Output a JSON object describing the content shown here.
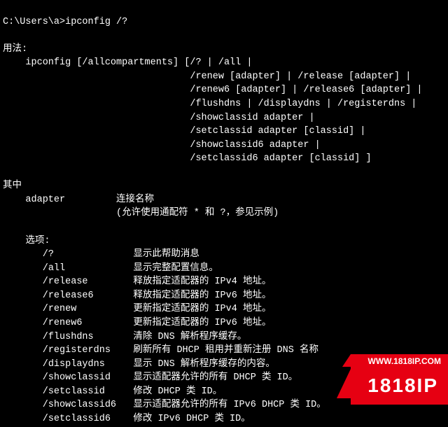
{
  "prompt": "C:\\Users\\a>ipconfig /?",
  "usage_label": "用法:",
  "usage_lines": [
    "    ipconfig [/allcompartments] [/? | /all |",
    "                                 /renew [adapter] | /release [adapter] |",
    "                                 /renew6 [adapter] | /release6 [adapter] |",
    "                                 /flushdns | /displaydns | /registerdns |",
    "                                 /showclassid adapter |",
    "                                 /setclassid adapter [classid] |",
    "                                 /showclassid6 adapter |",
    "                                 /setclassid6 adapter [classid] ]"
  ],
  "where_label": "其中",
  "adapter_key": "    adapter",
  "adapter_desc1": "连接名称",
  "adapter_desc2": "(允许使用通配符 * 和 ?，参见示例)",
  "options_label": "    选项:",
  "options": [
    {
      "flag": "/?",
      "desc": "显示此帮助消息"
    },
    {
      "flag": "/all",
      "desc": "显示完整配置信息。"
    },
    {
      "flag": "/release",
      "desc": "释放指定适配器的 IPv4 地址。"
    },
    {
      "flag": "/release6",
      "desc": "释放指定适配器的 IPv6 地址。"
    },
    {
      "flag": "/renew",
      "desc": "更新指定适配器的 IPv4 地址。"
    },
    {
      "flag": "/renew6",
      "desc": "更新指定适配器的 IPv6 地址。"
    },
    {
      "flag": "/flushdns",
      "desc": "清除 DNS 解析程序缓存。"
    },
    {
      "flag": "/registerdns",
      "desc": "刷新所有 DHCP 租用并重新注册 DNS 名称"
    },
    {
      "flag": "/displaydns",
      "desc": "显示 DNS 解析程序缓存的内容。"
    },
    {
      "flag": "/showclassid",
      "desc": "显示适配器允许的所有 DHCP 类 ID。"
    },
    {
      "flag": "/setclassid",
      "desc": "修改 DHCP 类 ID。"
    },
    {
      "flag": "/showclassid6",
      "desc": "显示适配器允许的所有 IPv6 DHCP 类 ID。"
    },
    {
      "flag": "/setclassid6",
      "desc": "修改 IPv6 DHCP 类 ID。"
    }
  ],
  "watermark": {
    "url": "WWW.1818IP.COM",
    "brand": "1818IP"
  }
}
